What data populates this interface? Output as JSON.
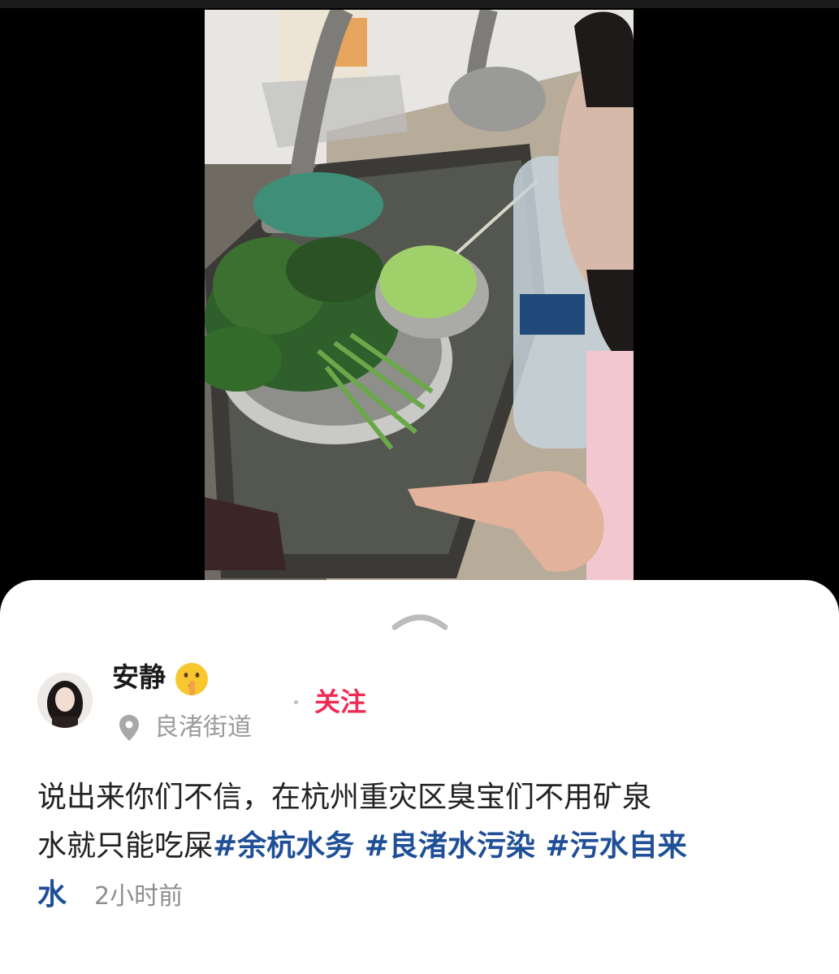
{
  "post": {
    "author": {
      "name": "安静",
      "emoji": "shushing-face-icon",
      "location": "良渚街道"
    },
    "follow_label": "关注",
    "caption_line1": "说出来你们不信，在杭州重灾区臭宝们不用矿泉",
    "caption_line2": "水就只能吃屎",
    "hashtags": [
      "#余杭水务 ",
      "#良渚水污染 ",
      "#污水自来",
      "水"
    ],
    "time_ago": "2小时前"
  },
  "icons": {
    "collapse": "chevron-up-icon",
    "location": "location-pin-icon"
  },
  "colors": {
    "hashtag": "#1f4f97",
    "follow": "#ef2a54",
    "secondary_text": "#9a9a9a"
  }
}
